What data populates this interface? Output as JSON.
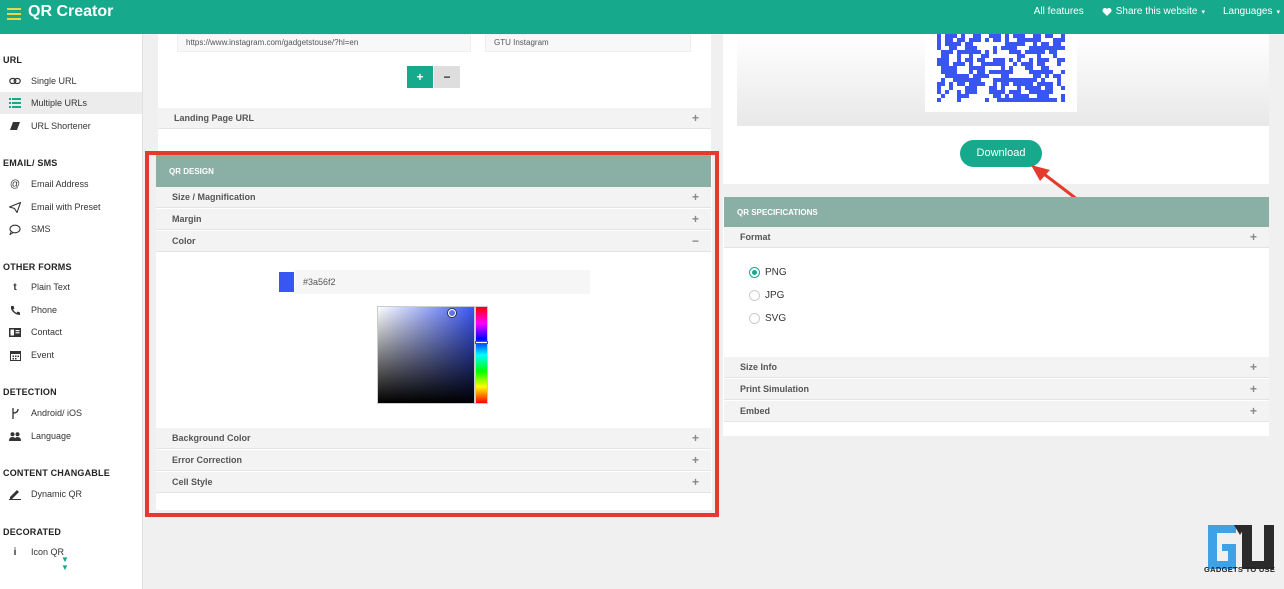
{
  "app": {
    "title": "QR Creator",
    "nav": [
      {
        "label": "All features"
      },
      {
        "label": "Share this website",
        "caret": "▾"
      },
      {
        "label": "Languages",
        "caret": "▾"
      }
    ]
  },
  "sidebar": {
    "sections": [
      {
        "title": "URL",
        "items": [
          {
            "label": "Single URL",
            "icon": "link-icon"
          },
          {
            "label": "Multiple URLs",
            "icon": "list-icon",
            "active": true
          },
          {
            "label": "URL Shortener",
            "icon": "eraser-icon"
          }
        ]
      },
      {
        "title": "EMAIL/ SMS",
        "items": [
          {
            "label": "Email Address",
            "icon": "at-icon"
          },
          {
            "label": "Email with Preset",
            "icon": "send-icon"
          },
          {
            "label": "SMS",
            "icon": "chat-icon"
          }
        ]
      },
      {
        "title": "OTHER FORMS",
        "items": [
          {
            "label": "Plain Text",
            "icon": "text-t-icon"
          },
          {
            "label": "Phone",
            "icon": "phone-icon"
          },
          {
            "label": "Contact",
            "icon": "contact-card-icon"
          },
          {
            "label": "Event",
            "icon": "calendar-icon"
          }
        ]
      },
      {
        "title": "DETECTION",
        "items": [
          {
            "label": "Android/ iOS",
            "icon": "fork-icon"
          },
          {
            "label": "Language",
            "icon": "people-icon"
          }
        ]
      },
      {
        "title": "CONTENT CHANGABLE",
        "items": [
          {
            "label": "Dynamic QR",
            "icon": "pen-icon"
          }
        ]
      },
      {
        "title": "DECORATED",
        "items": [
          {
            "label": "Icon QR",
            "icon": "info-icon"
          }
        ]
      }
    ]
  },
  "url_inputs": {
    "url_value": "https://www.instagram.com/gadgetstouse/?hl=en",
    "label_value": "GTU Instagram",
    "add_label": "+",
    "remove_label": "−"
  },
  "landing_page": {
    "label": "Landing Page URL",
    "toggle": "+"
  },
  "qr_design": {
    "header": "QR DESIGN",
    "rows_top": [
      {
        "label": "Size / Magnification",
        "toggle": "+"
      },
      {
        "label": "Margin",
        "toggle": "+"
      },
      {
        "label": "Color",
        "toggle": "−"
      }
    ],
    "color_value": "#3a56f2",
    "swatch_color": "#3a56f2",
    "hue_fraction": 0.35,
    "rows_bottom": [
      {
        "label": "Background Color",
        "toggle": "+"
      },
      {
        "label": "Error Correction",
        "toggle": "+"
      },
      {
        "label": "Cell Style",
        "toggle": "+"
      }
    ]
  },
  "download": {
    "label": "Download"
  },
  "specs": {
    "header": "QR SPECIFICATIONS",
    "format_label": "Format",
    "format_toggle": "+",
    "formats": [
      {
        "label": "PNG",
        "checked": true
      },
      {
        "label": "JPG",
        "checked": false
      },
      {
        "label": "SVG",
        "checked": false
      }
    ],
    "rows": [
      {
        "label": "Size Info",
        "toggle": "+"
      },
      {
        "label": "Print Simulation",
        "toggle": "+"
      },
      {
        "label": "Embed",
        "toggle": "+"
      }
    ]
  },
  "watermark": {
    "text": "GADGETS TO USE"
  },
  "colors": {
    "accent": "#17a98c",
    "header_bg": "#8aafa4",
    "highlight": "#e53b2e",
    "qr": "#3a56f2"
  }
}
